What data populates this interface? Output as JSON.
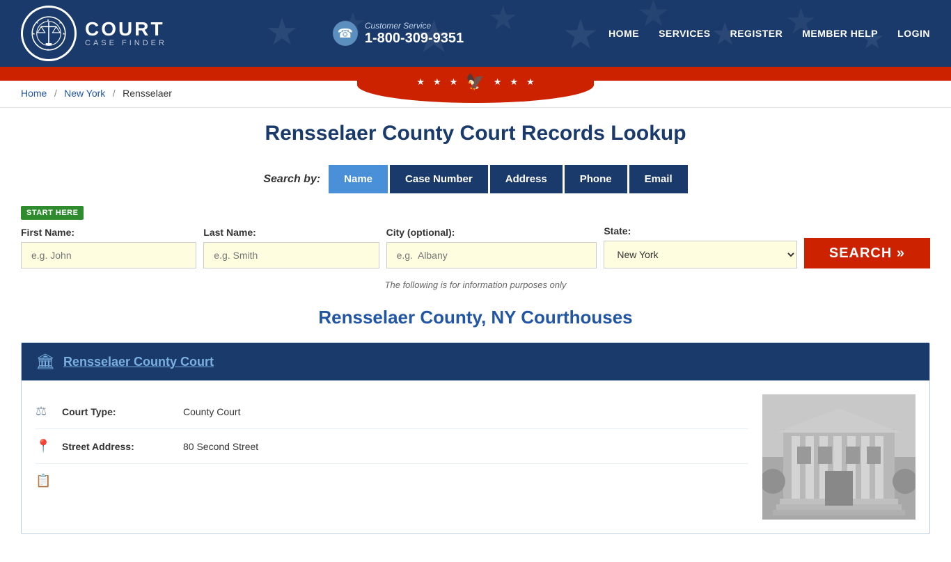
{
  "header": {
    "logo_court": "COURT",
    "logo_case_finder": "CASE FINDER",
    "customer_service_label": "Customer Service",
    "phone": "1-800-309-9351",
    "nav": [
      {
        "label": "HOME",
        "id": "nav-home"
      },
      {
        "label": "SERVICES",
        "id": "nav-services"
      },
      {
        "label": "REGISTER",
        "id": "nav-register"
      },
      {
        "label": "MEMBER HELP",
        "id": "nav-member-help"
      },
      {
        "label": "LOGIN",
        "id": "nav-login"
      }
    ]
  },
  "breadcrumb": {
    "home": "Home",
    "state": "New York",
    "county": "Rensselaer"
  },
  "page_title": "Rensselaer County Court Records Lookup",
  "search": {
    "search_by_label": "Search by:",
    "tabs": [
      {
        "label": "Name",
        "active": true
      },
      {
        "label": "Case Number",
        "active": false
      },
      {
        "label": "Address",
        "active": false
      },
      {
        "label": "Phone",
        "active": false
      },
      {
        "label": "Email",
        "active": false
      }
    ],
    "start_here": "START HERE",
    "fields": {
      "first_name_label": "First Name:",
      "first_name_placeholder": "e.g. John",
      "last_name_label": "Last Name:",
      "last_name_placeholder": "e.g. Smith",
      "city_label": "City (optional):",
      "city_placeholder": "e.g.  Albany",
      "state_label": "State:",
      "state_value": "New York"
    },
    "search_button": "SEARCH »",
    "disclaimer": "The following is for information purposes only"
  },
  "county_section_title": "Rensselaer County, NY Courthouses",
  "courthouse": {
    "name": "Rensselaer County Court",
    "court_type_label": "Court Type:",
    "court_type_value": "County Court",
    "street_address_label": "Street Address:",
    "street_address_value": "80 Second Street"
  },
  "colors": {
    "dark_blue": "#1a3a6b",
    "accent_blue": "#4a90d9",
    "red": "#cc2200",
    "green": "#2e8b2e",
    "link_blue": "#2255a4"
  }
}
